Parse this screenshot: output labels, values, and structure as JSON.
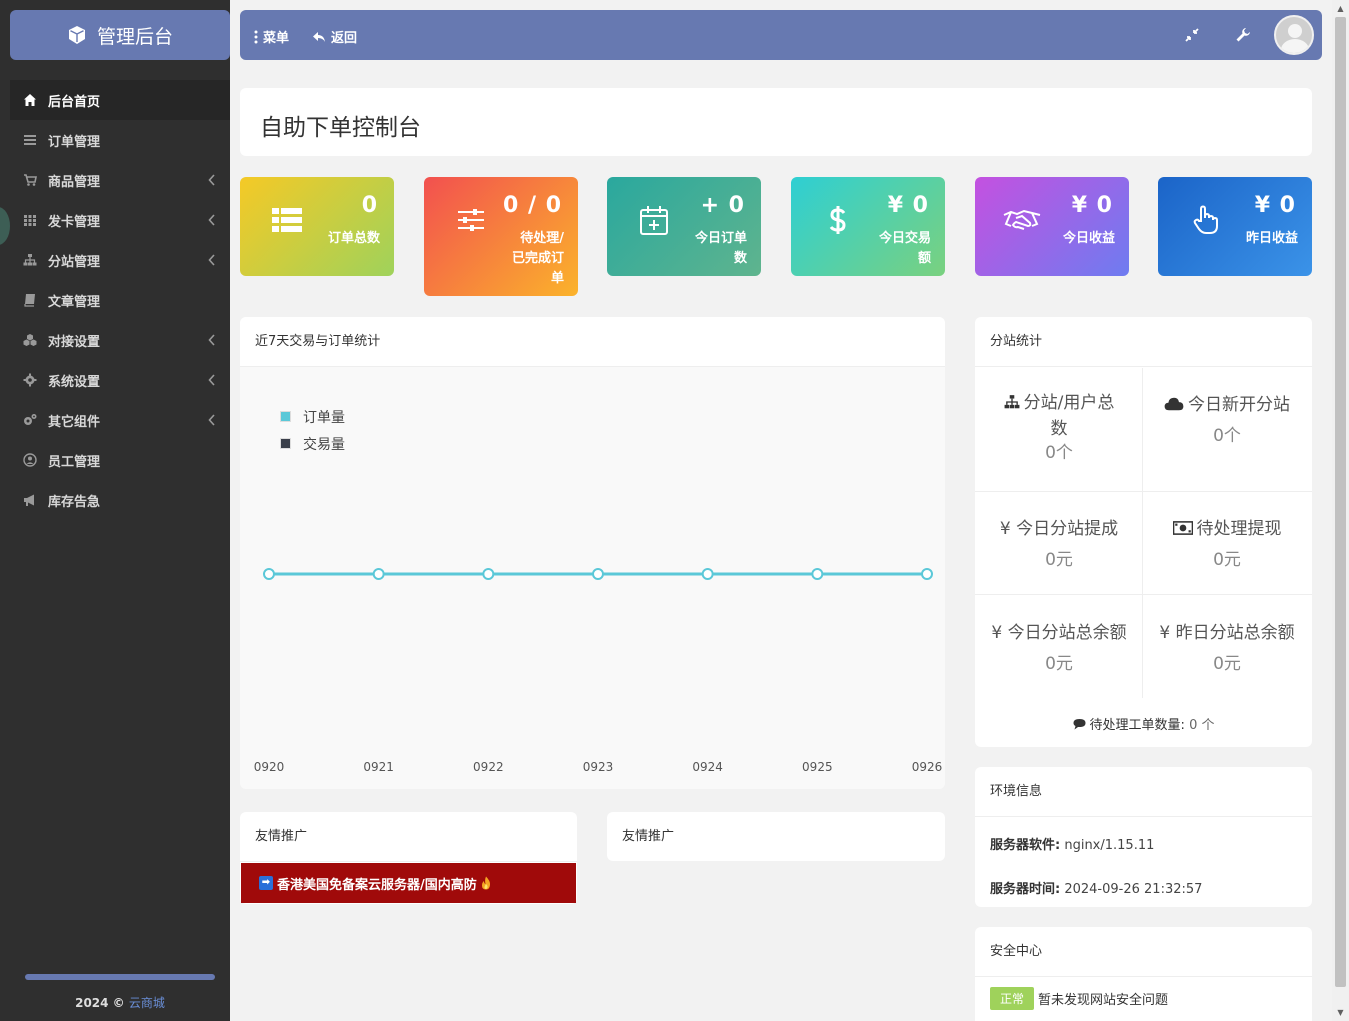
{
  "brand": {
    "title": "管理后台",
    "icon": "cube-icon"
  },
  "sidebar": {
    "items": [
      {
        "label": "后台首页",
        "icon": "home-icon",
        "active": true,
        "has_children": false
      },
      {
        "label": "订单管理",
        "icon": "list-icon",
        "active": false,
        "has_children": false
      },
      {
        "label": "商品管理",
        "icon": "cart-icon",
        "active": false,
        "has_children": true
      },
      {
        "label": "发卡管理",
        "icon": "grid-icon",
        "active": false,
        "has_children": true
      },
      {
        "label": "分站管理",
        "icon": "sitemap-icon",
        "active": false,
        "has_children": true
      },
      {
        "label": "文章管理",
        "icon": "book-icon",
        "active": false,
        "has_children": false
      },
      {
        "label": "对接设置",
        "icon": "cubes-icon",
        "active": false,
        "has_children": true
      },
      {
        "label": "系统设置",
        "icon": "gear-icon",
        "active": false,
        "has_children": true
      },
      {
        "label": "其它组件",
        "icon": "gears-icon",
        "active": false,
        "has_children": true
      },
      {
        "label": "员工管理",
        "icon": "user-circle-icon",
        "active": false,
        "has_children": false
      },
      {
        "label": "库存告急",
        "icon": "bullhorn-icon",
        "active": false,
        "has_children": false
      }
    ],
    "footer_year": "2024 ©",
    "footer_link": "云商城"
  },
  "topbar": {
    "menu_label": "菜单",
    "back_label": "返回"
  },
  "page": {
    "title": "自助下单控制台"
  },
  "stats": [
    {
      "value": "0",
      "label": "订单总数",
      "icon": "list-icon"
    },
    {
      "value": "0 / 0",
      "label": "待处理/已完成订单",
      "icon": "sliders-icon"
    },
    {
      "value": "+ 0",
      "label": "今日订单数",
      "icon": "calendar-plus-icon"
    },
    {
      "value": "¥ 0",
      "label": "今日交易额",
      "icon": "dollar-icon"
    },
    {
      "value": "¥ 0",
      "label": "今日收益",
      "icon": "handshake-icon"
    },
    {
      "value": "¥ 0",
      "label": "昨日收益",
      "icon": "hand-pointer-icon"
    }
  ],
  "chart_panel": {
    "title": "近7天交易与订单统计"
  },
  "chart_data": {
    "type": "line",
    "categories": [
      "0920",
      "0921",
      "0922",
      "0923",
      "0924",
      "0925",
      "0926"
    ],
    "series": [
      {
        "name": "订单量",
        "values": [
          0,
          0,
          0,
          0,
          0,
          0,
          0
        ],
        "color": "#5bc8d8"
      },
      {
        "name": "交易量",
        "values": [
          0,
          0,
          0,
          0,
          0,
          0,
          0
        ],
        "color": "#3a3f4a"
      }
    ],
    "ylim": [
      0,
      1
    ],
    "legend": "top-left",
    "grid": false
  },
  "branch_panel": {
    "title": "分站统计",
    "cells": [
      {
        "title": "分站/用户总数",
        "value": "0个",
        "icon": "sitemap-icon"
      },
      {
        "title": "今日新开分站",
        "value": "0个",
        "icon": "cloud-icon"
      },
      {
        "title": "¥ 今日分站提成",
        "value": "0元"
      },
      {
        "title": "待处理提现",
        "value": "0元",
        "icon": "money-icon"
      },
      {
        "title": "¥ 今日分站总余额",
        "value": "0元"
      },
      {
        "title": "¥ 昨日分站总余额",
        "value": "0元"
      }
    ],
    "ticket_label": "待处理工单数量:",
    "ticket_count": "0 个"
  },
  "env_panel": {
    "title": "环境信息",
    "server_software_label": "服务器软件:",
    "server_software": "nginx/1.15.11",
    "server_time_label": "服务器时间:",
    "server_time": "2024-09-26 21:32:57"
  },
  "security_panel": {
    "title": "安全中心",
    "status": "正常",
    "message": "暂未发现网站安全问题"
  },
  "promo": [
    {
      "title": "友情推广",
      "link_text": "香港美国免备案云服务器/国内高防"
    },
    {
      "title": "友情推广"
    }
  ],
  "colors": {
    "accent": "#6779b1",
    "sidebar": "#2f2f2f",
    "ok": "#9fd25b",
    "promo": "#a00a0a"
  }
}
